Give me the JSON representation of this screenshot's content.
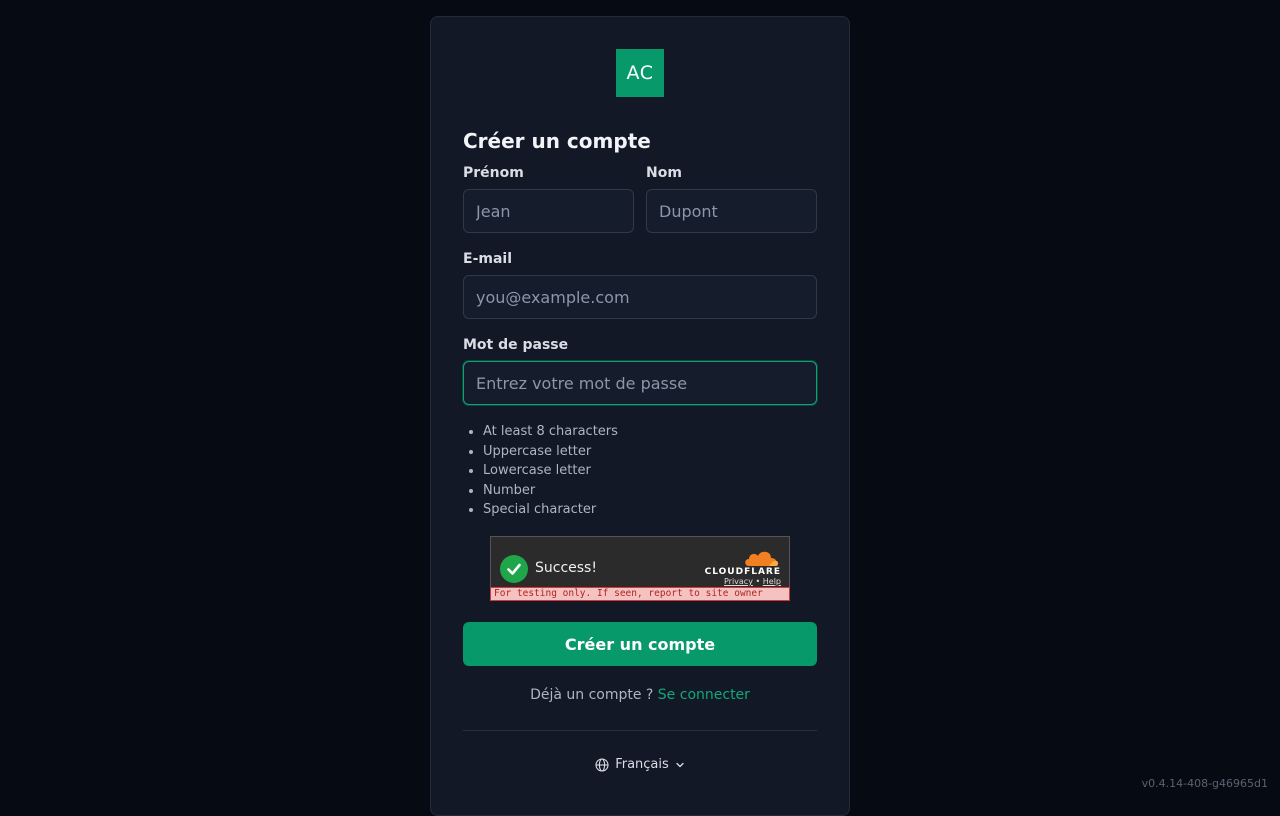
{
  "logo": {
    "text": "AC",
    "color": "#08996a"
  },
  "form": {
    "title": "Créer un compte",
    "first_name": {
      "label": "Prénom",
      "placeholder": "Jean",
      "value": ""
    },
    "last_name": {
      "label": "Nom",
      "placeholder": "Dupont",
      "value": ""
    },
    "email": {
      "label": "E-mail",
      "placeholder": "you@example.com",
      "value": ""
    },
    "password": {
      "label": "Mot de passe",
      "placeholder": "Entrez votre mot de passe",
      "value": "",
      "focused": true
    },
    "password_rules": [
      "At least 8 characters",
      "Uppercase letter",
      "Lowercase letter",
      "Number",
      "Special character"
    ],
    "submit_label": "Créer un compte",
    "signin_prompt": "Déjà un compte ?",
    "signin_link": "Se connecter"
  },
  "captcha": {
    "status": "Success!",
    "brand": "CLOUDFLARE",
    "privacy_link": "Privacy",
    "separator": "•",
    "help_link": "Help",
    "warning": "For testing only. If seen, report to site owner"
  },
  "language": {
    "selected": "Français",
    "icon": "globe-icon"
  },
  "version": "v0.4.14-408-g46965d1",
  "colors": {
    "background": "#060a12",
    "card": "#121826",
    "accent": "#08996a",
    "link": "#10a978"
  }
}
